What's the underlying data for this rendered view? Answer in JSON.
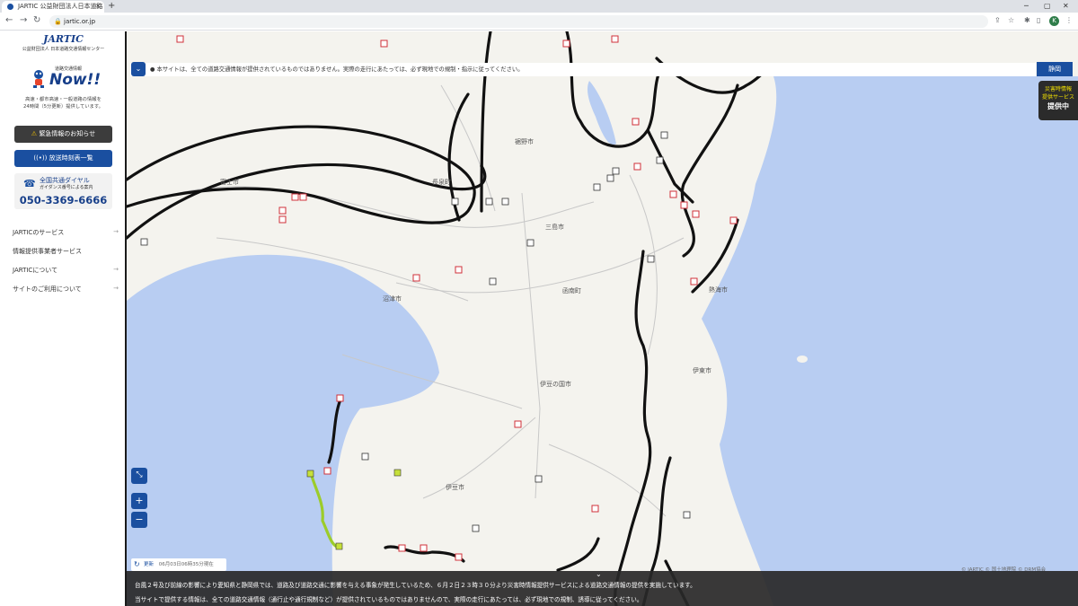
{
  "browser": {
    "tab_title": "JARTIC 公益財団法人日本道路",
    "url": "jartic.or.jp",
    "profile_initial": "K"
  },
  "sidebar": {
    "logo": "JARTIC",
    "logo_sub": "公益財団法人 日本道路交通情報センター",
    "now_label": "道路交通情報",
    "now_title": "Now!!",
    "desc_line1": "高速・都市高速・一般道路の情報を",
    "desc_line2": "24時間（5分更新）提供しています。",
    "emergency_button": "緊急情報のお知らせ",
    "broadcast_button": "放送時刻表一覧",
    "phone_label": "全国共通ダイヤル",
    "phone_sub": "ガイダンス番号による案内",
    "phone_number": "050-3369-6666",
    "menu": [
      {
        "label": "JARTICのサービス",
        "has_chevron": true
      },
      {
        "label": "情報提供事業者サービス",
        "has_chevron": false
      },
      {
        "label": "JARTICについて",
        "has_chevron": true
      },
      {
        "label": "サイトのご利用について",
        "has_chevron": true
      }
    ]
  },
  "map": {
    "notice": "本サイトは、全ての道路交通情報が提供されているものではありません。実際の走行にあたっては、必ず現地での規制・指示に従ってください。",
    "prefecture_button": "静岡",
    "disaster_badge": {
      "line1": "災害時情報",
      "line2": "提供サービス",
      "line3": "提供中"
    },
    "update_label": "更新",
    "update_time": "06月03日06時35分現在",
    "attribution": "© JARTIC  © 国土地理院  © DRM協会",
    "place_labels": [
      "富士市",
      "長泉町",
      "三島市",
      "裾野市",
      "函南町",
      "熱海市",
      "伊豆の国市",
      "伊豆市",
      "沼津市",
      "伊東市"
    ],
    "colors": {
      "sea": "#b8cdf2",
      "land": "#f4f3ee",
      "road_closed": "#111111",
      "caution": "#9ccc2a",
      "accent": "#1a4fa0"
    }
  },
  "banner": {
    "line1": "台風２号及び前線の影響により愛知県と静岡県では、道路及び道路交通に影響を与える事象が発生しているため、６月２日２３時３０分より災害時情報提供サービスによる道路交通情報の提供を実施しています。",
    "line2": "当サイトで提供する情報は、全ての道路交通情報（通行止や通行規制など）が提供されているものではありませんので、実際の走行にあたっては、必ず現地での規制、誘導に従ってください。"
  }
}
